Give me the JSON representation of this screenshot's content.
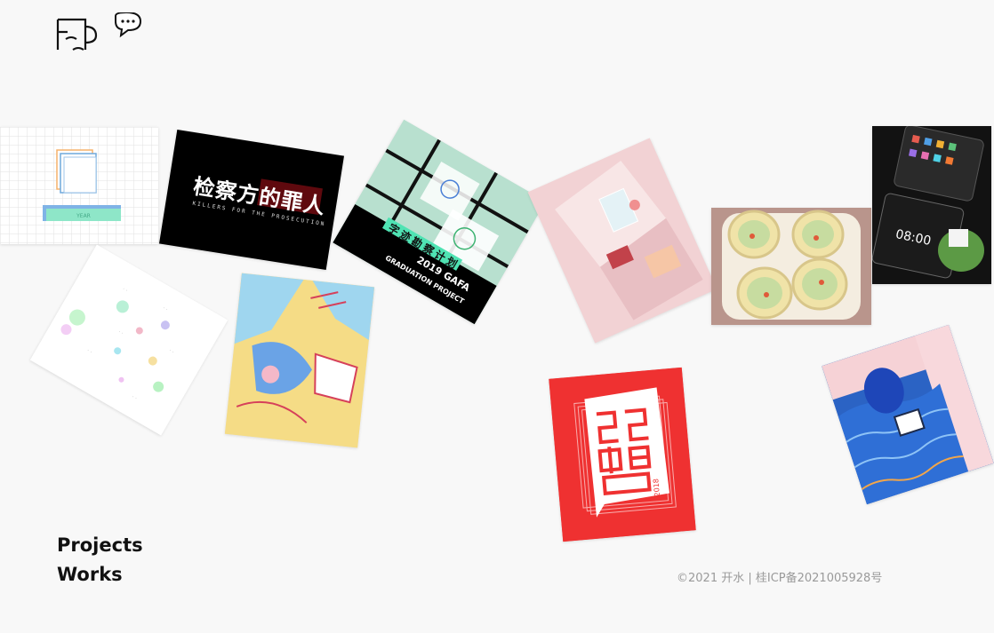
{
  "brand": {
    "logo_name": "kaishui-mug-logo",
    "chat_icon": "speech-bubble-icon"
  },
  "gallery": {
    "cards": [
      {
        "id": "grid-paper-folder"
      },
      {
        "id": "prosecutor-movie-poster",
        "title": "检察方的罪人",
        "subtitle": "KILLERS FOR THE PROSECUTION"
      },
      {
        "id": "graduation-project",
        "title": "字迹勘察计划",
        "subtitle": "2019 GAFA",
        "caption": "GRADUATION PROJECT"
      },
      {
        "id": "isometric-room"
      },
      {
        "id": "toast-illustration"
      },
      {
        "id": "phone-ui-mockup",
        "time": "08:00"
      },
      {
        "id": "pastel-dots-poster"
      },
      {
        "id": "colorful-illustration"
      },
      {
        "id": "red-typography-poster",
        "year": "2018"
      },
      {
        "id": "ocean-illustration"
      }
    ]
  },
  "nav": {
    "projects": "Projects",
    "works": "Works"
  },
  "footer": {
    "copyright": "©2021 开水 | 桂ICP备2021005928号"
  }
}
